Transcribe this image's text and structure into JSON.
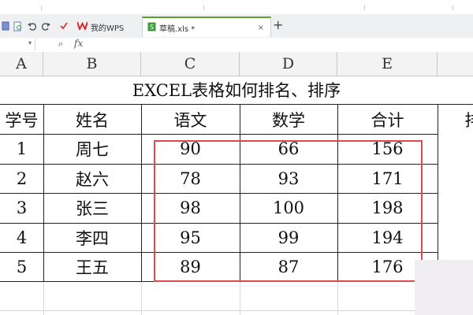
{
  "tabs": {
    "home_label": "我的WPS",
    "file_label": "草稿.xls *",
    "close_glyph": "×",
    "new_tab_glyph": "+"
  },
  "formula_bar": {
    "name_value": "",
    "zoom_glyph": "⌕",
    "fx_label": "fx",
    "formula_value": ""
  },
  "columns": [
    "A",
    "B",
    "C",
    "D",
    "E"
  ],
  "sheet": {
    "title": "EXCEL表格如何排名、排序",
    "headers": [
      "学号",
      "姓名",
      "语文",
      "数学",
      "合计",
      "排"
    ],
    "rows": [
      {
        "id": "1",
        "name": "周七",
        "chinese": "90",
        "math": "66",
        "total": "156"
      },
      {
        "id": "2",
        "name": "赵六",
        "chinese": "78",
        "math": "93",
        "total": "171"
      },
      {
        "id": "3",
        "name": "张三",
        "chinese": "98",
        "math": "100",
        "total": "198"
      },
      {
        "id": "4",
        "name": "李四",
        "chinese": "95",
        "math": "99",
        "total": "194"
      },
      {
        "id": "5",
        "name": "王五",
        "chinese": "89",
        "math": "87",
        "total": "176"
      }
    ]
  },
  "colors": {
    "highlight_border": "#e0484f",
    "active_tab_accent": "#5aa02c",
    "wps_brand": "#d9262c"
  }
}
